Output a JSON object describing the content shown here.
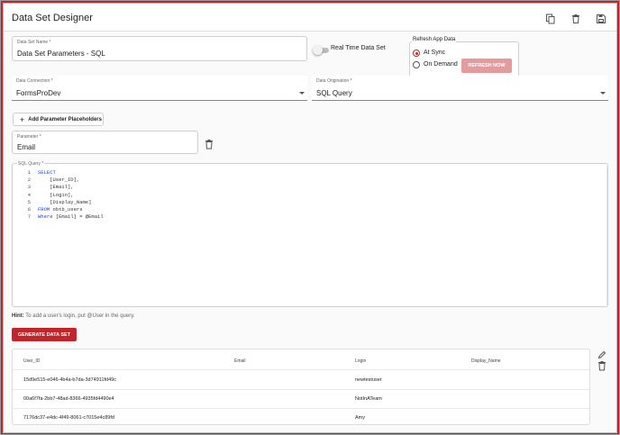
{
  "window": {
    "title": "Data Set Designer",
    "copy_icon": "copy-icon",
    "delete_icon": "trash-icon",
    "save_icon": "save-icon"
  },
  "form": {
    "data_set_name": {
      "label": "Data Set Name *",
      "value": "Data Set Parameters - SQL"
    },
    "real_time": {
      "label": "Real Time Data Set",
      "checked": false
    },
    "refresh": {
      "legend": "Refresh App Data",
      "options": [
        {
          "label": "At Sync",
          "selected": true
        },
        {
          "label": "On Demand",
          "selected": false
        }
      ],
      "refresh_button": "REFRESH NOW"
    },
    "data_connection": {
      "label": "Data Connection *",
      "value": "FormsProDev"
    },
    "data_origination": {
      "label": "Data Origination *",
      "value": "SQL Query"
    },
    "add_placeholders_label": "Add Parameter Placeholders",
    "parameter": {
      "label": "Parameter *",
      "value": "Email"
    },
    "sql_query_label": "SQL Query *"
  },
  "editor": {
    "lines": [
      {
        "n": "1",
        "parts": [
          {
            "t": "SELECT",
            "kw": true
          }
        ]
      },
      {
        "n": "2",
        "parts": [
          {
            "t": "    [User_ID],",
            "kw": false
          }
        ]
      },
      {
        "n": "3",
        "parts": [
          {
            "t": "    [Email],",
            "kw": false
          }
        ]
      },
      {
        "n": "4",
        "parts": [
          {
            "t": "    [Login],",
            "kw": false
          }
        ]
      },
      {
        "n": "5",
        "parts": [
          {
            "t": "    [Display_Name]",
            "kw": false
          }
        ]
      },
      {
        "n": "6",
        "parts": [
          {
            "t": "FROM",
            "kw": true
          },
          {
            "t": " obtb_users",
            "kw": false
          }
        ]
      },
      {
        "n": "7",
        "parts": [
          {
            "t": "Where",
            "kw": true
          },
          {
            "t": " [Email] = @Email",
            "kw": false
          }
        ]
      }
    ]
  },
  "hint": {
    "bold": "Hint:",
    "text": " To add a user's login, put @User in the query."
  },
  "generate_label": "GENERATE DATA SET",
  "results": {
    "columns": [
      "User_ID",
      "Email",
      "Login",
      "Display_Name"
    ],
    "rows": [
      [
        "15d9e515-e046-4b4a-b7da-3d74911fd49c",
        "",
        "newtestuser",
        ""
      ],
      [
        "00a6f7fa-2bb7-48ad-8366-4935fd4490e4",
        "",
        "NotInATeam",
        ""
      ],
      [
        "7176dc37-e4dc-4f49-8061-c7015e4c89fd",
        "",
        "Amy",
        ""
      ]
    ],
    "edit_icon": "pencil-icon",
    "delete_icon": "trash-icon"
  },
  "colors": {
    "accent": "#c3242a",
    "keyword": "#1a3dd6"
  }
}
